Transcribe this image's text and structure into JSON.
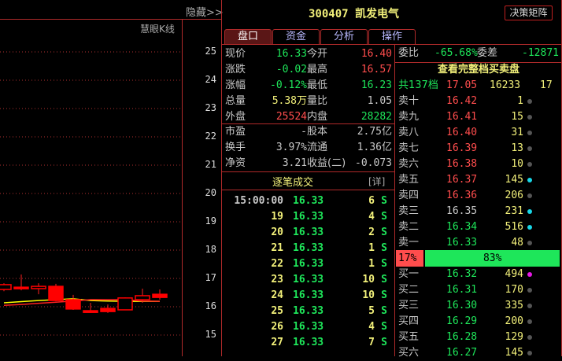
{
  "left": {
    "hide_label": "隐藏>>",
    "indicator_label": "慧眼K线",
    "y_ticks": [
      "25",
      "24",
      "23",
      "22",
      "21",
      "20",
      "19",
      "18",
      "17",
      "16",
      "15"
    ],
    "chart_data": {
      "type": "candlestick",
      "ylim": [
        14.6,
        25.4
      ],
      "y_ticks": [
        25,
        24,
        23,
        22,
        21,
        20,
        19,
        18,
        17,
        16,
        15
      ],
      "candles": [
        {
          "o": 16.61,
          "c": 16.78,
          "h": 16.83,
          "l": 16.55
        },
        {
          "o": 16.69,
          "c": 16.64,
          "h": 17.14,
          "l": 16.58
        },
        {
          "o": 16.64,
          "c": 16.72,
          "h": 16.83,
          "l": 16.44
        },
        {
          "o": 16.72,
          "c": 16.22,
          "h": 16.81,
          "l": 16.19
        },
        {
          "o": 16.25,
          "c": 15.92,
          "h": 16.42,
          "l": 15.89
        },
        {
          "o": 15.86,
          "c": 15.8,
          "h": 16.14,
          "l": 15.78
        },
        {
          "o": 15.94,
          "c": 15.83,
          "h": 16.08,
          "l": 15.78
        },
        {
          "o": 15.89,
          "c": 16.31,
          "h": 16.33,
          "l": 15.89
        },
        {
          "o": 16.25,
          "c": 16.39,
          "h": 16.64,
          "l": 16.14
        },
        {
          "o": 16.44,
          "c": 16.33,
          "h": 16.61,
          "l": 16.25
        }
      ],
      "ma_yellow": [
        16.14,
        16.18,
        16.22,
        16.25,
        16.28,
        16.22,
        16.2,
        16.19,
        16.19,
        16.19
      ],
      "ma_red": [
        16.05,
        16.08,
        16.12,
        16.16,
        16.2,
        16.25,
        16.25,
        16.25,
        16.2,
        16.19
      ]
    }
  },
  "header": {
    "code": "300407",
    "name": "凯发电气",
    "decision_button": "决策矩阵"
  },
  "tabs": [
    "盘口",
    "资金",
    "分析",
    "操作"
  ],
  "quote": [
    {
      "l1": "现价",
      "v1": "16.33",
      "c1": "g",
      "l2": "今开",
      "v2": "16.40",
      "c2": "r"
    },
    {
      "l1": "涨跌",
      "v1": "-0.02",
      "c1": "g",
      "l2": "最高",
      "v2": "16.57",
      "c2": "r"
    },
    {
      "l1": "涨幅",
      "v1": "-0.12%",
      "c1": "g",
      "l2": "最低",
      "v2": "16.23",
      "c2": "g"
    },
    {
      "l1": "总量",
      "v1": "5.38万",
      "c1": "y",
      "l2": "量比",
      "v2": "1.05",
      "c2": "w"
    },
    {
      "l1": "外盘",
      "v1": "25524",
      "c1": "r",
      "l2": "内盘",
      "v2": "28282",
      "c2": "g"
    }
  ],
  "fund": [
    {
      "l1": "市盈",
      "v1": "-",
      "l2": "股本",
      "v2": "2.75亿"
    },
    {
      "l1": "换手",
      "v1": "3.97%",
      "l2": "流通",
      "v2": "1.36亿"
    },
    {
      "l1": "净资",
      "v1": "3.21",
      "l2": "收益(二)",
      "v2": "-0.073"
    }
  ],
  "ticks": {
    "title": "逐笔成交",
    "detail": "[详]",
    "rows": [
      {
        "t": "15:00:00",
        "p": "16.33",
        "v": "6",
        "s": "S"
      },
      {
        "t": "19",
        "p": "16.33",
        "v": "4",
        "s": "S"
      },
      {
        "t": "20",
        "p": "16.33",
        "v": "2",
        "s": "S"
      },
      {
        "t": "21",
        "p": "16.33",
        "v": "1",
        "s": "S"
      },
      {
        "t": "22",
        "p": "16.33",
        "v": "1",
        "s": "S"
      },
      {
        "t": "23",
        "p": "16.33",
        "v": "10",
        "s": "S"
      },
      {
        "t": "24",
        "p": "16.33",
        "v": "10",
        "s": "S"
      },
      {
        "t": "25",
        "p": "16.33",
        "v": "5",
        "s": "S"
      },
      {
        "t": "26",
        "p": "16.33",
        "v": "4",
        "s": "S"
      },
      {
        "t": "27",
        "p": "16.33",
        "v": "7",
        "s": "S"
      }
    ]
  },
  "book": {
    "wb_label": "委比",
    "wb": "-65.68%",
    "wc_label": "委差",
    "wc": "-12871",
    "full_link": "查看完整档买卖盘",
    "total": {
      "label": "共137档",
      "price": "17.05",
      "vol": "16233",
      "n": "17"
    },
    "asks": [
      {
        "l": "卖十",
        "p": "16.42",
        "v": "1",
        "pc": "r",
        "dot": "#555"
      },
      {
        "l": "卖九",
        "p": "16.41",
        "v": "15",
        "pc": "r",
        "dot": "#555"
      },
      {
        "l": "卖八",
        "p": "16.40",
        "v": "31",
        "pc": "r",
        "dot": "#555"
      },
      {
        "l": "卖七",
        "p": "16.39",
        "v": "13",
        "pc": "r",
        "dot": "#555"
      },
      {
        "l": "卖六",
        "p": "16.38",
        "v": "10",
        "pc": "r",
        "dot": "#555"
      },
      {
        "l": "卖五",
        "p": "16.37",
        "v": "145",
        "pc": "r",
        "dot": "#19d6e6"
      },
      {
        "l": "卖四",
        "p": "16.36",
        "v": "206",
        "pc": "r",
        "dot": "#555"
      },
      {
        "l": "卖三",
        "p": "16.35",
        "v": "231",
        "pc": "w",
        "dot": "#19d6e6"
      },
      {
        "l": "卖二",
        "p": "16.34",
        "v": "516",
        "pc": "g",
        "dot": "#19d6e6"
      },
      {
        "l": "卖一",
        "p": "16.33",
        "v": "48",
        "pc": "g",
        "dot": "#555"
      }
    ],
    "ratio": {
      "sell": "17%",
      "buy": "83%",
      "sell_frac": 0.17
    },
    "bids": [
      {
        "l": "买一",
        "p": "16.32",
        "v": "494",
        "pc": "g",
        "dot": "#e619e6"
      },
      {
        "l": "买二",
        "p": "16.31",
        "v": "170",
        "pc": "g",
        "dot": "#555"
      },
      {
        "l": "买三",
        "p": "16.30",
        "v": "335",
        "pc": "g",
        "dot": "#555"
      },
      {
        "l": "买四",
        "p": "16.29",
        "v": "200",
        "pc": "g",
        "dot": "#555"
      },
      {
        "l": "买五",
        "p": "16.28",
        "v": "129",
        "pc": "g",
        "dot": "#555"
      },
      {
        "l": "买六",
        "p": "16.27",
        "v": "145",
        "pc": "g",
        "dot": "#555"
      }
    ]
  }
}
